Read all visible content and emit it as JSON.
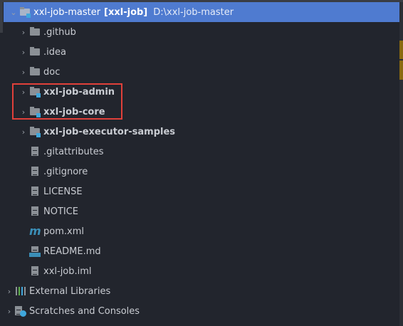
{
  "root": {
    "name": "xxl-job-master",
    "module": "[xxl-job]",
    "path": "D:\\xxl-job-master"
  },
  "items": [
    {
      "label": ".github",
      "icon": "folder-icon",
      "bold": false
    },
    {
      "label": ".idea",
      "icon": "folder-icon",
      "bold": false
    },
    {
      "label": "doc",
      "icon": "folder-icon",
      "bold": false
    },
    {
      "label": "xxl-job-admin",
      "icon": "module-folder-icon",
      "bold": true
    },
    {
      "label": "xxl-job-core",
      "icon": "module-folder-icon",
      "bold": true
    },
    {
      "label": "xxl-job-executor-samples",
      "icon": "module-folder-icon",
      "bold": true
    },
    {
      "label": ".gitattributes",
      "icon": "text-file-icon"
    },
    {
      "label": ".gitignore",
      "icon": "ignore-file-icon"
    },
    {
      "label": "LICENSE",
      "icon": "text-file-icon"
    },
    {
      "label": "NOTICE",
      "icon": "text-file-icon"
    },
    {
      "label": "pom.xml",
      "icon": "maven-icon"
    },
    {
      "label": "README.md",
      "icon": "markdown-icon"
    },
    {
      "label": "xxl-job.iml",
      "icon": "iml-file-icon"
    }
  ],
  "bottom": [
    {
      "label": "External Libraries",
      "icon": "libraries-icon"
    },
    {
      "label": "Scratches and Consoles",
      "icon": "scratches-icon"
    }
  ],
  "colors": {
    "selection": "#4f7bd0",
    "highlight": "#e0403a",
    "background": "#22252d"
  }
}
